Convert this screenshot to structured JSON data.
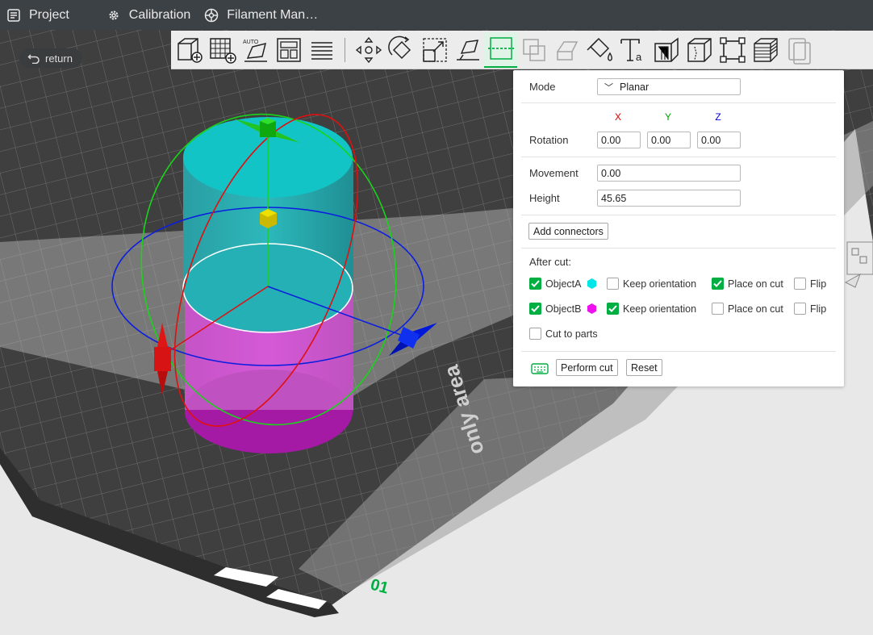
{
  "topbar": {
    "project": "Project",
    "calibration": "Calibration",
    "filament": "Filament Man…"
  },
  "scene": {
    "return_label": "return",
    "plate_text": "only area",
    "plate_number": "01"
  },
  "toolbar": {
    "icons": [
      "add-object",
      "add-plate",
      "auto-orient",
      "arrange",
      "split",
      "move",
      "rotate",
      "scale",
      "lay-on-face",
      "cut",
      "mesh-boolean",
      "support-paint",
      "seam-paint",
      "text",
      "emboss",
      "assembly",
      "measure",
      "variable-layer-height",
      "brim-ears"
    ]
  },
  "cut_panel": {
    "mode_label": "Mode",
    "mode_value": "Planar",
    "axis_x": "X",
    "axis_y": "Y",
    "axis_z": "Z",
    "rotation_label": "Rotation",
    "rotation_x": "0.00",
    "rotation_y": "0.00",
    "rotation_z": "0.00",
    "movement_label": "Movement",
    "movement_value": "0.00",
    "height_label": "Height",
    "height_value": "45.65",
    "add_connectors": "Add connectors",
    "after_cut_label": "After cut:",
    "object_a": {
      "label": "ObjectA",
      "checked": true,
      "color": "#00e5e5",
      "keep_orientation": false,
      "place_on_cut": true,
      "flip": false
    },
    "object_b": {
      "label": "ObjectB",
      "checked": true,
      "color": "#ee11ee",
      "keep_orientation": true,
      "place_on_cut": false,
      "flip": false
    },
    "keep_orientation_label": "Keep orientation",
    "place_on_cut_label": "Place on cut",
    "flip_label": "Flip",
    "cut_to_parts_label": "Cut to parts",
    "cut_to_parts": false,
    "perform_cut": "Perform cut",
    "reset": "Reset"
  },
  "colors": {
    "accent": "#00ae42",
    "axis_x": "#e00000",
    "axis_y": "#00a000",
    "axis_z": "#0000e0",
    "topbar_bg": "#3c4145"
  }
}
